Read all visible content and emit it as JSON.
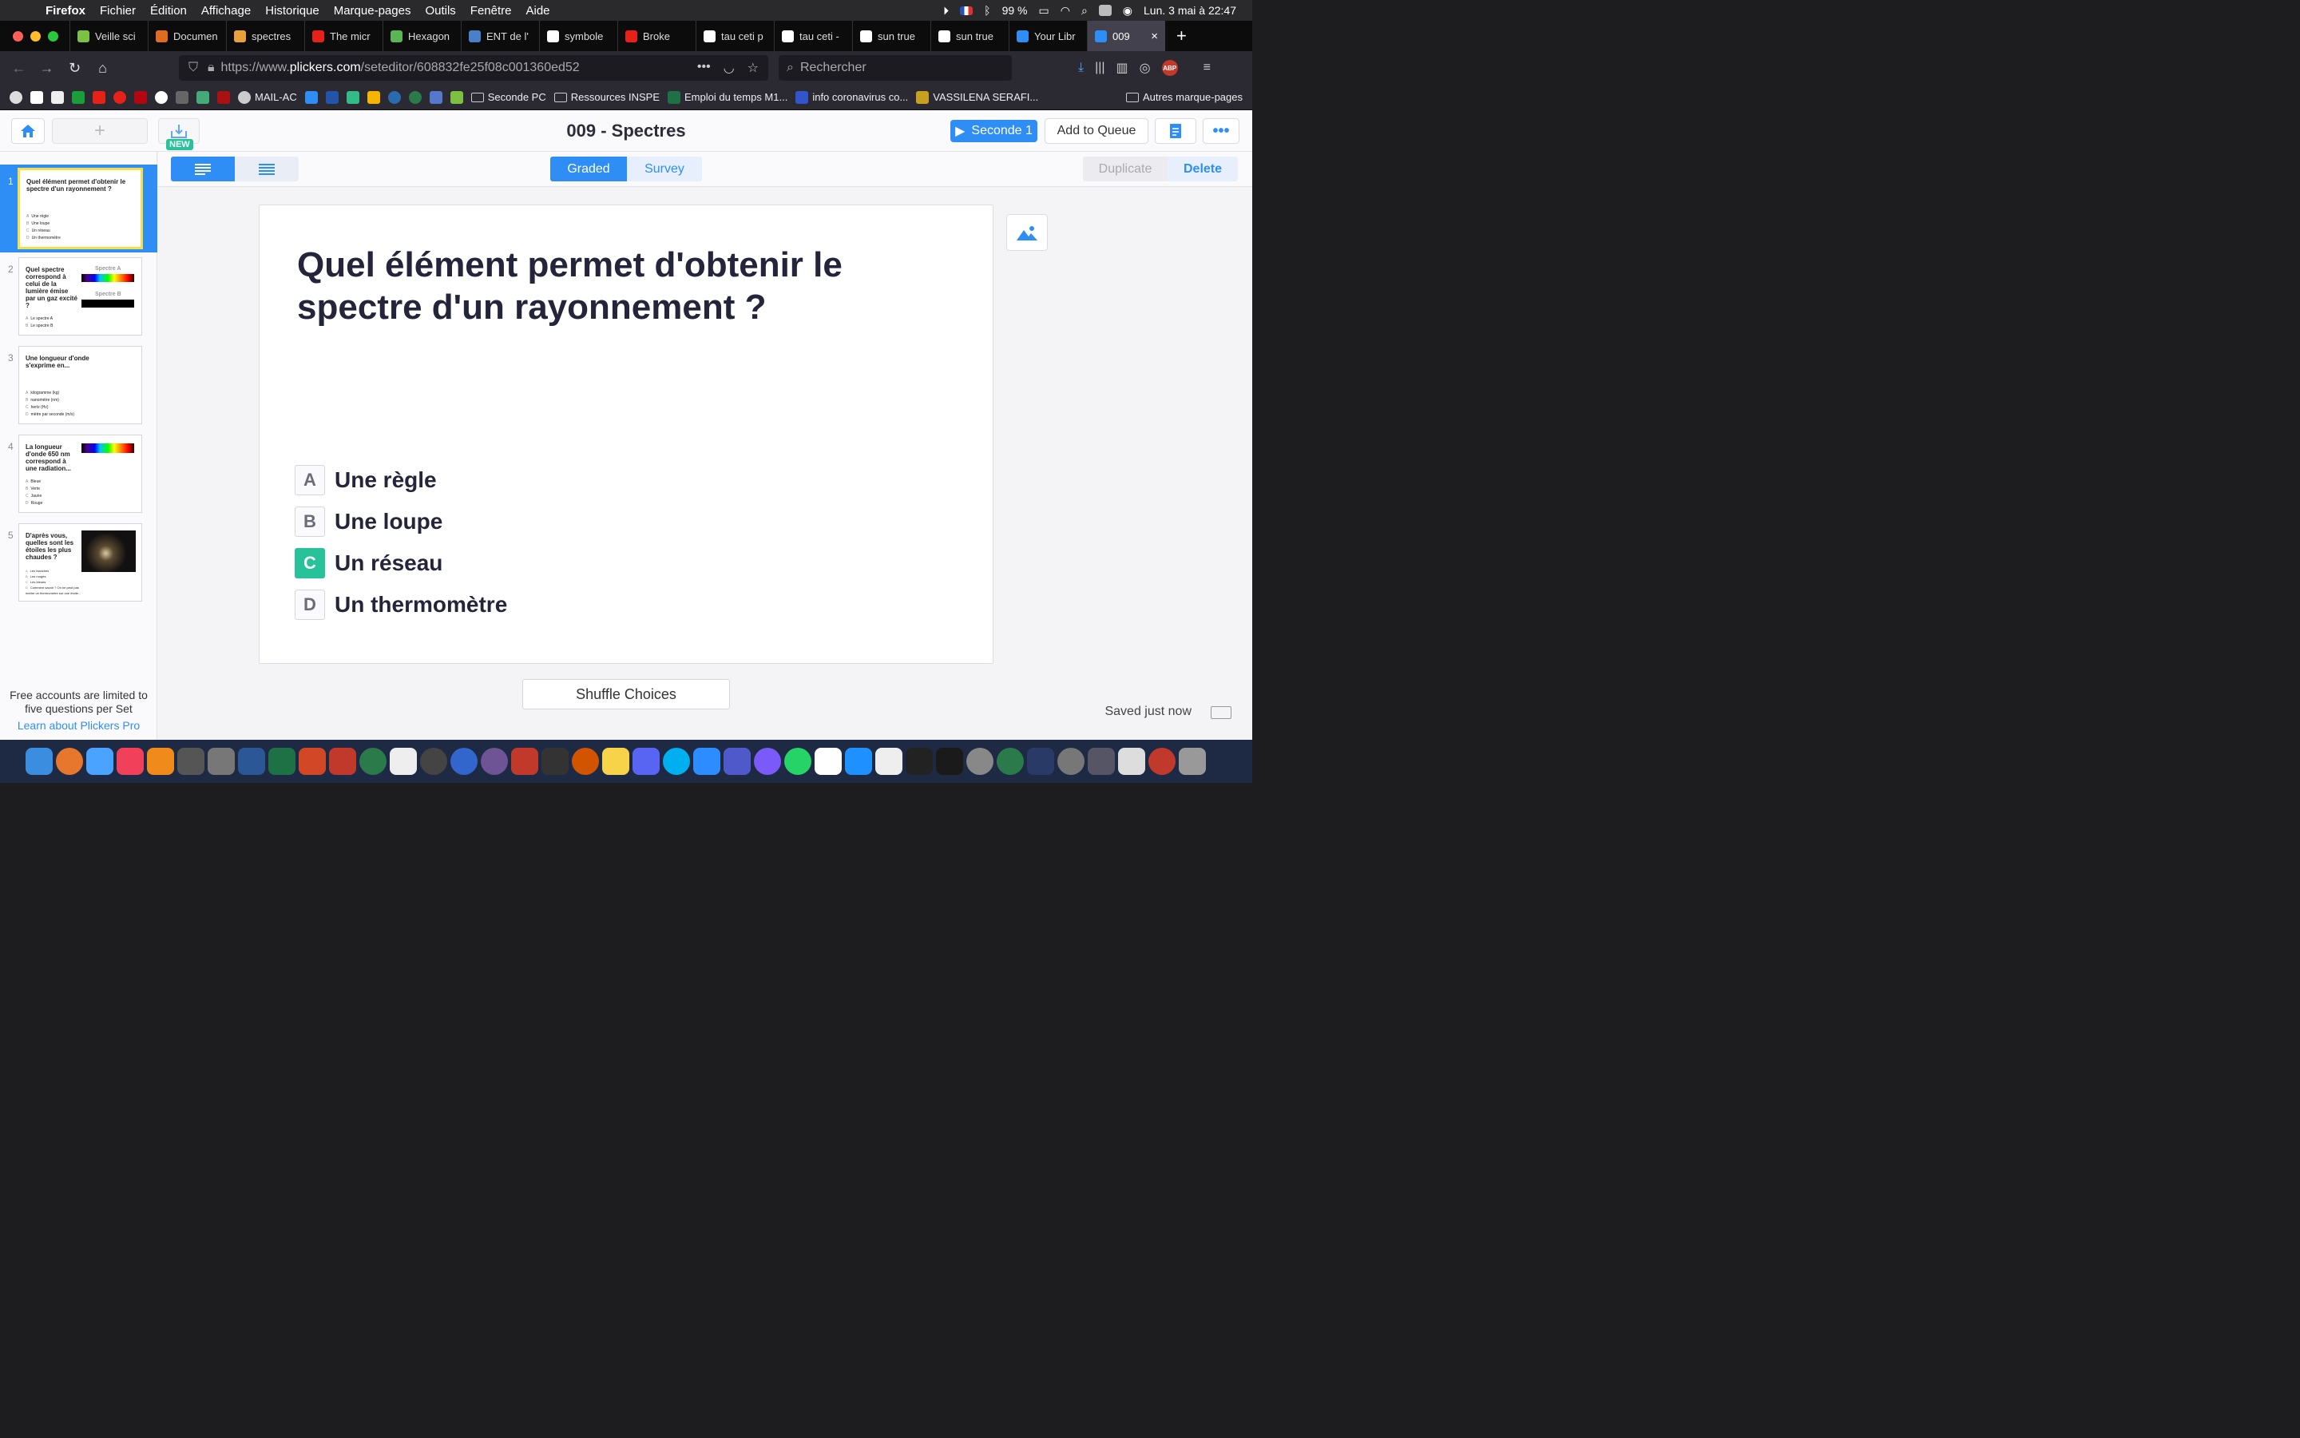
{
  "menubar": {
    "app": "Firefox",
    "items": [
      "Fichier",
      "Édition",
      "Affichage",
      "Historique",
      "Marque-pages",
      "Outils",
      "Fenêtre",
      "Aide"
    ],
    "battery": "99 %",
    "datetime": "Lun. 3 mai à  22:47"
  },
  "tabs": [
    {
      "label": "Veille sci",
      "color": "#7cc142"
    },
    {
      "label": "Documen",
      "color": "#e06c1f"
    },
    {
      "label": "spectres",
      "color": "#e8a13a"
    },
    {
      "label": "The micr",
      "color": "#e62117"
    },
    {
      "label": "Hexagon",
      "color": "#5bb552"
    },
    {
      "label": "ENT de l'",
      "color": "#4a7fc9"
    },
    {
      "label": "symbole",
      "color": "#ffffff"
    },
    {
      "label": "Broke",
      "color": "#e62117"
    },
    {
      "label": "tau ceti p",
      "color": "#ffffff"
    },
    {
      "label": "tau ceti -",
      "color": "#ffffff"
    },
    {
      "label": "sun true",
      "color": "#ffffff"
    },
    {
      "label": "sun true",
      "color": "#ffffff"
    },
    {
      "label": "Your Libr",
      "color": "#2f8ef6"
    },
    {
      "label": "009",
      "color": "#2f8ef6",
      "active": true
    }
  ],
  "navbar": {
    "url_prefix": "https://www.",
    "url_domain": "plickers.com",
    "url_path": "/seteditor/608832fe25f08c001360ed52",
    "search_placeholder": "Rechercher"
  },
  "bookmarks": {
    "items": [
      "MAIL-AC",
      "Seconde PC",
      "Ressources INSPE",
      "Emploi du temps M1...",
      "info coronavirus co...",
      "VASSILENA SERAFI..."
    ],
    "other": "Autres marque-pages"
  },
  "header": {
    "new_badge": "NEW",
    "set_title": "009 - Spectres",
    "class_button": "Seconde 1",
    "queue_button": "Add to Queue"
  },
  "toolbar": {
    "graded": "Graded",
    "survey": "Survey",
    "duplicate": "Duplicate",
    "delete": "Delete"
  },
  "sidebar": {
    "slides": [
      {
        "num": "1",
        "question": "Quel élément permet d'obtenir le spectre d'un rayonnement ?",
        "choices": [
          "Une règle",
          "Une loupe",
          "Un réseau",
          "Un thermomètre"
        ]
      },
      {
        "num": "2",
        "question": "Quel spectre correspond à celui de la lumière émise par un gaz excité ?",
        "spectrum_a": "Spectre A",
        "spectrum_b": "Spectre B",
        "choices": [
          "Le spectre A",
          "Le spectre B"
        ]
      },
      {
        "num": "3",
        "question": "Une longueur d'onde s'exprime en...",
        "choices": [
          "kilogramme (kg)",
          "nanomètre (nm)",
          "hertz (Hz)",
          "mètre par seconde (m/s)"
        ]
      },
      {
        "num": "4",
        "question": "La longueur d'onde 650 nm correspond à une radiation...",
        "choices": [
          "Bleue",
          "Verte",
          "Jaune",
          "Rouge"
        ]
      },
      {
        "num": "5",
        "question": "D'après vous, quelles sont les étoiles les plus chaudes ?",
        "choices": [
          "Les blanches",
          "Les rouges",
          "Les bleues",
          "Comment savoir ? On ne peut pas mettre un thermomètre sur une étoile..."
        ]
      }
    ],
    "limit_text": "Free accounts are limited to five questions per Set",
    "learn_link": "Learn about Plickers Pro"
  },
  "question": {
    "text": "Quel élément permet d'obtenir le spectre d'un rayonnement ?",
    "choices": [
      {
        "letter": "A",
        "text": "Une règle",
        "correct": false
      },
      {
        "letter": "B",
        "text": "Une loupe",
        "correct": false
      },
      {
        "letter": "C",
        "text": "Un réseau",
        "correct": true
      },
      {
        "letter": "D",
        "text": "Un thermomètre",
        "correct": false
      }
    ]
  },
  "footer": {
    "shuffle": "Shuffle Choices",
    "saved": "Saved just now"
  },
  "colors": {
    "accent": "#2f8ef6",
    "correct": "#27c29a",
    "active_slide_border": "#f5e04a"
  }
}
